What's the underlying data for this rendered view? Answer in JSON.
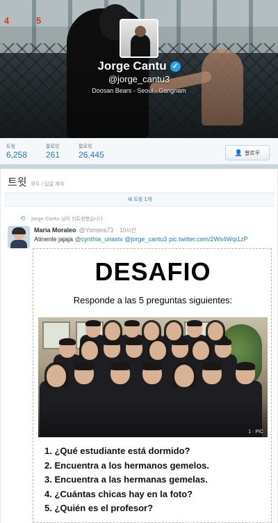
{
  "profile": {
    "name": "Jorge Cantu",
    "handle": "@jorge_cantu3",
    "location": "Doosan Bears - Seoul - Gangnam"
  },
  "stats": [
    {
      "label": "트윗",
      "value": "6,258"
    },
    {
      "label": "팔로잉",
      "value": "261"
    },
    {
      "label": "팔로워",
      "value": "26,445"
    }
  ],
  "follow_button": {
    "label": "팔로우"
  },
  "tweets_section": {
    "title": "트윗",
    "subtitle": "모두 / 답글 제외",
    "new_tweets": "새 트윗 1개"
  },
  "tweet": {
    "retweet_context": "Jorge Cantu 님이 리트윗했습니다",
    "author_name": "Maria Moraleo",
    "author_handle": "@Yomera73",
    "time": "· 10시간",
    "text_plain": "Atinenle jajaja ",
    "mentions": [
      "@cynthia_uriastv",
      "@jorge_cantu3"
    ],
    "link": "pic.twitter.com/2Ws4Wqi1zP"
  },
  "image": {
    "title": "DESAFIO",
    "subtitle": "Responde a las 5 preguntas siguientes:",
    "watermark": "1 · PIC",
    "questions": [
      "1. ¿Qué estudiante está dormido?",
      "2. Encuentra a los hermanos gemelos.",
      "3. Encuentra a las hermanas gemelas.",
      "4. ¿Cuántas chicas hay en la foto?",
      "5. ¿Quién es el profesor?"
    ]
  },
  "colors": {
    "link": "#2a7ab6",
    "verified": "#2aa3ef",
    "retweet": "#5dba5d"
  },
  "icons": {
    "verified": "verified-badge-icon",
    "follow": "add-user-icon",
    "retweet": "retweet-icon"
  }
}
